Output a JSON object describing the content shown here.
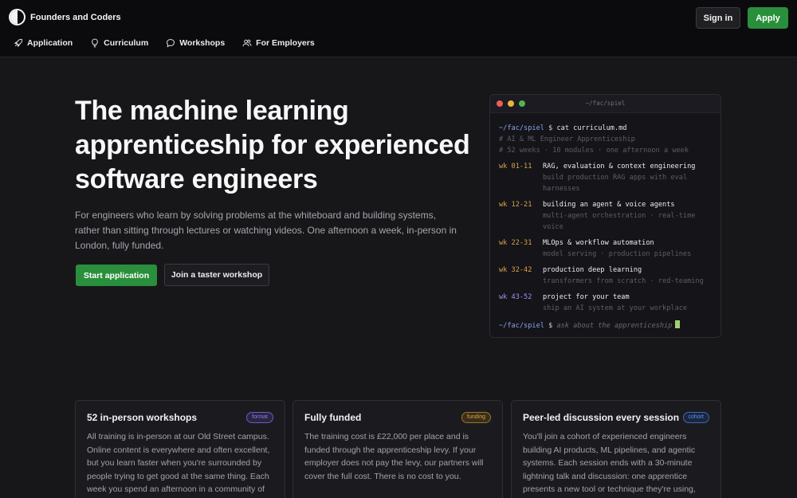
{
  "header": {
    "brand": "Founders and Coders",
    "sign_in": "Sign in",
    "apply": "Apply",
    "nav": [
      {
        "label": "Application",
        "icon": "rocket-icon"
      },
      {
        "label": "Curriculum",
        "icon": "lightbulb-icon"
      },
      {
        "label": "Workshops",
        "icon": "chat-icon"
      },
      {
        "label": "For Employers",
        "icon": "users-icon"
      }
    ]
  },
  "hero": {
    "title_lines": [
      "The machine learning",
      "apprenticeship for experienced",
      "software engineers"
    ],
    "subtitle_lines": [
      "For engineers who learn by solving problems at the whiteboard and building systems,",
      "rather than sitting through lectures or watching videos. One afternoon a week, in-person in",
      "London, fully funded."
    ],
    "start_button": "Start application",
    "taster_button": "Join a taster workshop"
  },
  "terminal": {
    "title": "~/fac/spiel",
    "prompt": "~/fac/spiel",
    "dollar": "$",
    "command": "cat curriculum.md",
    "comments": [
      "# AI & ML Engineer Apprenticeship",
      "# 52 weeks · 10 modules · one afternoon a week"
    ],
    "modules": [
      {
        "weeks": "wk 01-11",
        "title": "RAG, evaluation & context engineering",
        "detail": "build production RAG apps with eval harnesses"
      },
      {
        "weeks": "wk 12-21",
        "title": "building an agent & voice agents",
        "detail": "multi-agent orchestration · real-time voice"
      },
      {
        "weeks": "wk 22-31",
        "title": "MLOps & workflow automation",
        "detail": "model serving · production pipelines"
      },
      {
        "weeks": "wk 32-42",
        "title": "production deep learning",
        "detail": "transformers from scratch · red-teaming"
      },
      {
        "weeks": "wk 43-52",
        "title": "project for your team",
        "detail": "ship an AI system at your workplace"
      }
    ],
    "ask": "ask about the apprenticeship"
  },
  "cards": [
    {
      "title": "52 in-person workshops",
      "badge": "format",
      "badge_color": "#8d7cf0",
      "body_lines": [
        "All training is in-person at our Old Street campus.",
        "Online content is everywhere and often excellent,",
        "but you learn faster when you're surrounded by",
        "people trying to get good at the same thing. Each",
        "week you spend an afternoon in a community of"
      ]
    },
    {
      "title": "Fully funded",
      "badge": "funding",
      "badge_color": "#d8a44a",
      "body_lines": [
        "The training cost is £22,000 per place and is",
        "funded through the apprenticeship levy. If your",
        "employer does not pay the levy, our partners will",
        "cover the full cost. There is no cost to you."
      ]
    },
    {
      "title": "Peer-led discussion every session",
      "badge": "cohort",
      "badge_color": "#5b8ff0",
      "body_lines": [
        "You'll join a cohort of experienced engineers",
        "building AI products, ML pipelines, and agentic",
        "systems. Each session ends with a 30-minute",
        "lightning talk and discussion: one apprentice",
        "presents a new tool or technique they're using,"
      ]
    }
  ]
}
